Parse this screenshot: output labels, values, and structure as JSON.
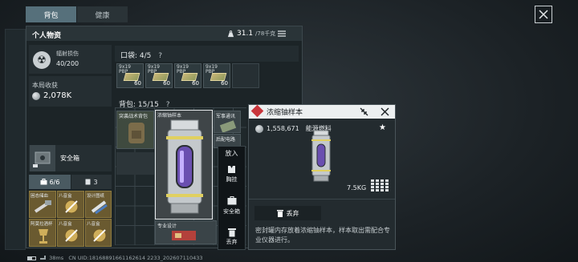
{
  "tabs": [
    {
      "label": "背包",
      "active": true
    },
    {
      "label": "健康",
      "active": false
    }
  ],
  "panel": {
    "title": "个人物资",
    "weight_value": "31.1",
    "weight_max": "/78千克"
  },
  "radiation": {
    "label": "辐射损伤",
    "value": "40/200"
  },
  "earnings": {
    "label": "本局收获",
    "value": "2,078K"
  },
  "safe_box": {
    "label": "安全箱",
    "counts": [
      "6/6",
      "3"
    ]
  },
  "pocket": {
    "label": "口袋:",
    "count": "4/5",
    "help": "?"
  },
  "ammo": [
    {
      "caliber": "9x19",
      "type": "PBP",
      "count": "60"
    },
    {
      "caliber": "9x19",
      "type": "PBP",
      "count": "60"
    },
    {
      "caliber": "9x19",
      "type": "PBP",
      "count": "60"
    },
    {
      "caliber": "9x19",
      "type": "PBP",
      "count": "60"
    }
  ],
  "backpack": {
    "label": "背包:",
    "count": "15/15",
    "help": "?"
  },
  "backpack_items": [
    {
      "name": "突袭战术背包"
    },
    {
      "name": "浓缩铀样本"
    },
    {
      "name": "军事通讯"
    },
    {
      "name": "后配电路"
    },
    {
      "name": "专业设计"
    }
  ],
  "left_grid_items": [
    {
      "name": "困态储血"
    },
    {
      "name": "八音盒"
    },
    {
      "name": "设计图纸"
    },
    {
      "name": "阿莫拉酒杯"
    },
    {
      "name": "八音盒"
    },
    {
      "name": "八音盒"
    }
  ],
  "context_menu": [
    {
      "label": "放入"
    },
    {
      "label": "胸挂"
    },
    {
      "label": "安全箱"
    },
    {
      "label": "丢弃"
    }
  ],
  "detail": {
    "title": "浓缩铀样本",
    "price": "1,558,671",
    "category": "能源燃料",
    "weight": "7.5KG",
    "discard_label": "丢弃",
    "description": "密封罐内存放着浓缩铀样本，样本取出需配合专业仪器进行。"
  },
  "footer": {
    "ping": "38ms",
    "uid": "CN UID:18168891661162614 2233_202607110433"
  },
  "colors": {
    "accent_tab": "#56707b",
    "rarity_red": "#c9363c",
    "selected_border": "#e6eaec"
  }
}
